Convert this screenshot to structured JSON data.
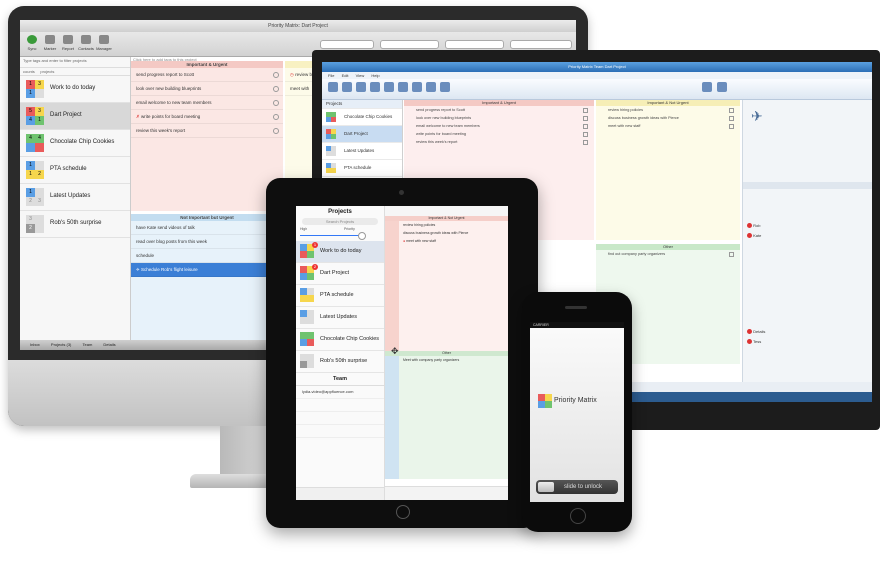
{
  "mac": {
    "title": "Priority Matrix: Dart Project",
    "toolbar": [
      "Sync",
      "Marker",
      "Report",
      "Contacts",
      "Manager"
    ],
    "search_placeholder": "Type tags and enter to filter projects",
    "tags_placeholder": "Click here to add tags to this project",
    "sidebar_header_left": "counts",
    "sidebar_header_right": "projects",
    "projects": [
      {
        "name": "Work to do today",
        "counts": [
          "1",
          "3",
          "1",
          ""
        ]
      },
      {
        "name": "Dart Project",
        "counts": [
          "5",
          "3",
          "4",
          "1"
        ]
      },
      {
        "name": "Chocolate Chip Cookies",
        "counts": [
          "4",
          "4",
          "",
          ""
        ]
      },
      {
        "name": "PTA schedule",
        "counts": [
          "1",
          "",
          "1",
          "2"
        ]
      },
      {
        "name": "Latest Updates",
        "counts": [
          "1",
          "",
          "2",
          "3"
        ]
      },
      {
        "name": "Rob's 50th surprise",
        "counts": [
          "3",
          "",
          "2",
          ""
        ]
      }
    ],
    "q1_title": "Important & Urgent",
    "q1_tasks": [
      "send progress report to Scott",
      "look over new building blueprints",
      "email welcome to new team members",
      "write points for board meeting",
      "review this week's report"
    ],
    "q3_title": "Not Important but Urgent",
    "q3_tasks": [
      "have Kate send videos of talk",
      "read over blog posts from this week",
      "schedule",
      "Schedule Rob's flight leisure"
    ],
    "q2_tasks": [
      "review bu",
      "meet with"
    ],
    "status_tabs": [
      "Inbox",
      "Projects (3)",
      "Team",
      "Details"
    ]
  },
  "win": {
    "title": "Priority Matrix Team Dart Project",
    "menu": [
      "File",
      "Edit",
      "View",
      "Help"
    ],
    "q1_title": "Important & Urgent",
    "q2_title": "Important & Not Urgent",
    "q4_title": "Other",
    "projects": [
      "Projects",
      "Chocolate Chip Cookies",
      "Dart Project",
      "Latest Updates",
      "PTA schedule",
      "Rob's 50th surprise"
    ],
    "q1_tasks": [
      "send progress report to Scott",
      "look over new building blueprints",
      "email welcome to new team members",
      "write points for board meeting",
      "review this week's report"
    ],
    "q2_tasks": [
      "review hiring policies",
      "discuss business growth ideas with Pierce",
      "meet with new staff"
    ],
    "q4_tasks": [
      "find out company party organizers"
    ],
    "right_items": [
      "Rob",
      "Kate",
      "Details",
      "Tess"
    ]
  },
  "ipad": {
    "title": "Projects",
    "search": "Search Projects",
    "slider_left": "High",
    "slider_right": "Priority",
    "projects": [
      {
        "name": "Work to do today",
        "badge": "1"
      },
      {
        "name": "Dart Project",
        "badge": "2"
      },
      {
        "name": "PTA schedule",
        "badge": ""
      },
      {
        "name": "Latest Updates",
        "badge": ""
      },
      {
        "name": "Chocolate Chip Cookies",
        "badge": ""
      },
      {
        "name": "Rob's 50th surprise",
        "badge": ""
      }
    ],
    "team_header": "Team",
    "team_email": "lydia-video@appfluence.com",
    "q1_title": "Important & Not Urgent",
    "q1_tasks": [
      "review hiring policies",
      "discuss business growth ideas with Pierce",
      "meet with new staff"
    ],
    "q3_title": "Other",
    "q3_tasks": [
      "Meet with company party organizers"
    ]
  },
  "iphone": {
    "carrier": "CARRIER",
    "brand": "Priority Matrix",
    "slide": "slide to unlock"
  },
  "colors": {
    "q1": "#e95b5b",
    "q2": "#f6d64d",
    "q3": "#5a9ee4",
    "q4": "#6fc36f",
    "selection": "#3b7fd6"
  }
}
